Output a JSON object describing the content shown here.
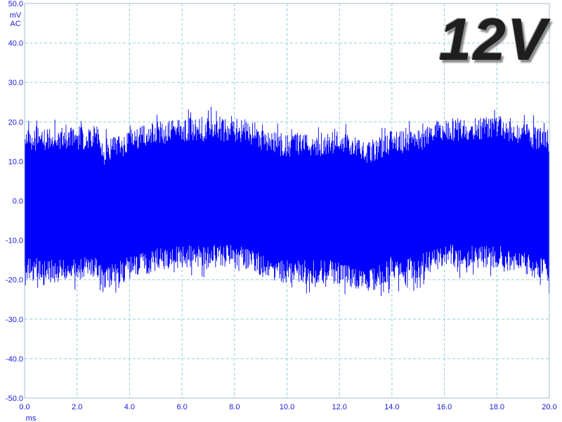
{
  "chart_data": {
    "type": "line",
    "title": "",
    "label": "12V",
    "y_unit_lines": [
      "mV",
      "AC"
    ],
    "xlabel": "ms",
    "ylabel": "",
    "xlim": [
      0,
      20
    ],
    "ylim": [
      -50,
      50
    ],
    "x_ticks": [
      "0.0",
      "2.0",
      "4.0",
      "6.0",
      "8.0",
      "10.0",
      "12.0",
      "14.0",
      "16.0",
      "18.0",
      "20.0"
    ],
    "y_ticks": [
      "50.0",
      "40.0",
      "30.0",
      "20.0",
      "10.0",
      "0.0",
      "-10.0",
      "-20.0",
      "-30.0",
      "-40.0",
      "-50.0"
    ],
    "grid": true,
    "series": [
      {
        "color": "#0000ff",
        "envelope": {
          "x": [
            0.0,
            1.0,
            2.0,
            2.8,
            3.0,
            4.0,
            5.0,
            6.0,
            7.0,
            8.0,
            8.8,
            9.2,
            10.0,
            11.0,
            12.0,
            13.0,
            14.0,
            15.0,
            15.5,
            16.0,
            17.0,
            18.0,
            19.0,
            20.0
          ],
          "upper": [
            15,
            16,
            16,
            16,
            12,
            15,
            17,
            18,
            18,
            18,
            17,
            15,
            14,
            14,
            15,
            12,
            15,
            15,
            17,
            18,
            18,
            19,
            17,
            15
          ],
          "lower": [
            -17,
            -18,
            -17,
            -17,
            -20,
            -17,
            -15,
            -14,
            -14,
            -14,
            -15,
            -17,
            -18,
            -18,
            -18,
            -21,
            -17,
            -17,
            -15,
            -14,
            -14,
            -14,
            -16,
            -18
          ]
        }
      }
    ]
  }
}
